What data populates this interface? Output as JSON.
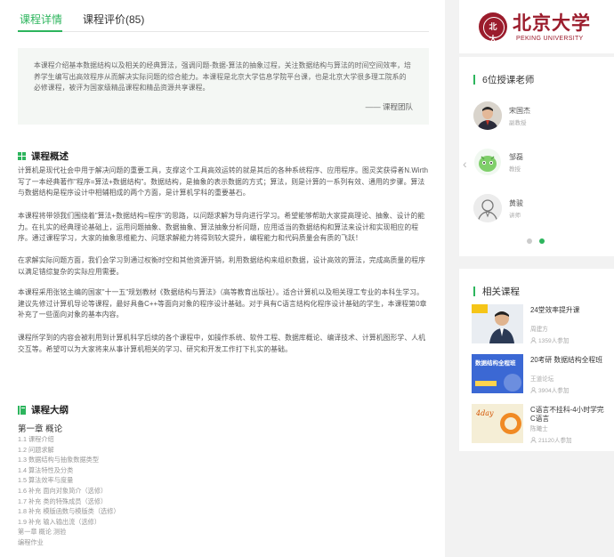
{
  "tabs": [
    {
      "label": "课程详情",
      "active": true
    },
    {
      "label": "课程评价(85)",
      "active": false
    }
  ],
  "intro": {
    "text": "本课程介绍基本数据结构以及相关的经典算法，强调问题-数据-算法的抽象过程，关注数据结构与算法的时间空间效率，培养学生编写出高效程序从而解决实际问题的综合能力。本课程是北京大学信息学院平台课，也是北京大学很多理工院系的必修课程，被评为国家级精品课程和精品资源共享课程。",
    "signature": "—— 课程团队"
  },
  "overview": {
    "title": "课程概述",
    "paragraphs": [
      "计算机是现代社会中用于解决问题的重要工具，支撑这个工具高效运转的就是其后的各种系统程序、应用程序。图灵奖获得者N.Wirth写了一本经典著作\"程序=算法+数据结构\"。数据结构，是抽象的表示数据的方式；算法，则是计算的一系列有效、通用的步骤。算法与数据结构是程序设计中相辅相成的两个方面，是计算机学科的重要基石。",
      "本课程将带领我们围绕着\"算法+数据结构=程序\"的思路，以问题求解为导向进行学习。希望能够帮助大家提高理论、抽象、设计的能力。在扎实的经典理论基础上，运用问题抽象、数据抽象、算法抽象分析问题，应用适当的数据结构和算法来设计和实现相应的程序。通过课程学习，大家的抽象思维能力、问题求解能力将得到较大提升，编程能力和代码质量会有质的飞跃！",
      "在求解实际问题方面，我们会学习到通过权衡时空和其他资源开销，利用数据结构来组织数据，设计高效的算法，完成高质量的程序以满足错综复杂的实际应用需要。",
      "本课程采用张铭主编的国家\"十一五\"规划教材《数据结构与算法》（高等教育出版社）。适合计算机以及相关理工专业的本科生学习。建议先修过计算机导论等课程，最好具备C++等面向对象的程序设计基础。对于具有C语言结构化程序设计基础的学生，本课程第0章补充了一些面向对象的基本内容。",
      "课程所学到的内容会被利用到计算机科学后续的各个课程中，如操作系统、软件工程、数据库概论、编译技术、计算机图形学、人机交互等。希望可以为大家将来从事计算机相关的学习、研究和开发工作打下扎实的基础。"
    ]
  },
  "syllabus": {
    "title": "课程大纲",
    "chapter": "第一章 概论",
    "items": [
      "1.1 课程介绍",
      "1.2 问题求解",
      "1.3 数据结构与抽象数据类型",
      "1.4 算法特性及分类",
      "1.5 算法效率与度量",
      "1.6 补充 面向对象简介（选修）",
      "1.7 补充 类的特殊成员（选修）",
      "1.8 补充 模版函数与模版类（选修）",
      "1.9 补充 输入输出流（选修）",
      "第一章 概论 测验",
      "编程作业"
    ]
  },
  "university": {
    "name": "北京大学",
    "english": "PEKING UNIVERSITY",
    "emblem_text": "北大"
  },
  "teachers": {
    "title": "6位授课老师",
    "list": [
      {
        "name": "宋国杰",
        "title": "副教授"
      },
      {
        "name": "邹磊",
        "title": "教授"
      },
      {
        "name": "黄骏",
        "title": "讲师"
      }
    ]
  },
  "related": {
    "title": "相关课程",
    "courses": [
      {
        "title": "24堂效率提升课",
        "author": "周建方",
        "count": "1359人参加"
      },
      {
        "title": "20考研 数据结构全程班",
        "author": "王道论坛",
        "count": "3904人参加",
        "thumb_text": "数据结构全程班"
      },
      {
        "title": "C语言不挂科-4小时学完C语言",
        "author": "陈曦士",
        "count": "21120人参加",
        "thumb_text": "4day"
      }
    ]
  },
  "colors": {
    "accent": "#2db55d",
    "brand": "#9b1c2c"
  }
}
